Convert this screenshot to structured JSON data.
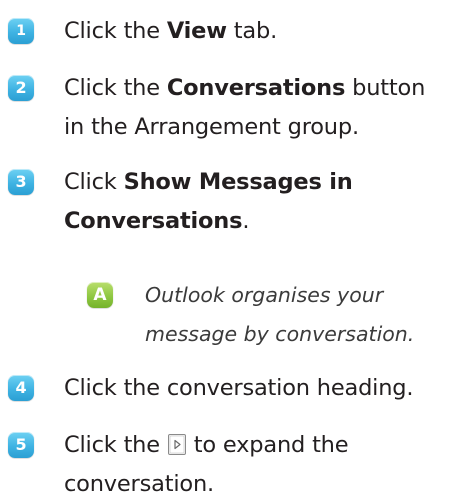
{
  "steps": [
    {
      "number": "1",
      "before": "Click the ",
      "bold": "View",
      "after": " tab."
    },
    {
      "number": "2",
      "line1_before": "Click the ",
      "line1_bold": "Conversations",
      "line1_after": " button",
      "line2": "in the Arrangement group."
    },
    {
      "number": "3",
      "line1_before": "Click ",
      "line1_bold": "Show Messages in",
      "line2_bold": "Conversations",
      "line2_after": "."
    },
    {
      "number": "4",
      "text": "Click the conversation heading."
    },
    {
      "number": "5",
      "line1_before": "Click the ",
      "line1_icon": "expand-arrow-icon",
      "line1_after": " to expand the",
      "line2": "conversation."
    }
  ],
  "callout": {
    "letter": "A",
    "line1": "Outlook organises your",
    "line2": "message by conversation."
  },
  "colors": {
    "step_badge": "#3fb3e3",
    "callout_badge": "#8cc63f",
    "text": "#231f20"
  }
}
